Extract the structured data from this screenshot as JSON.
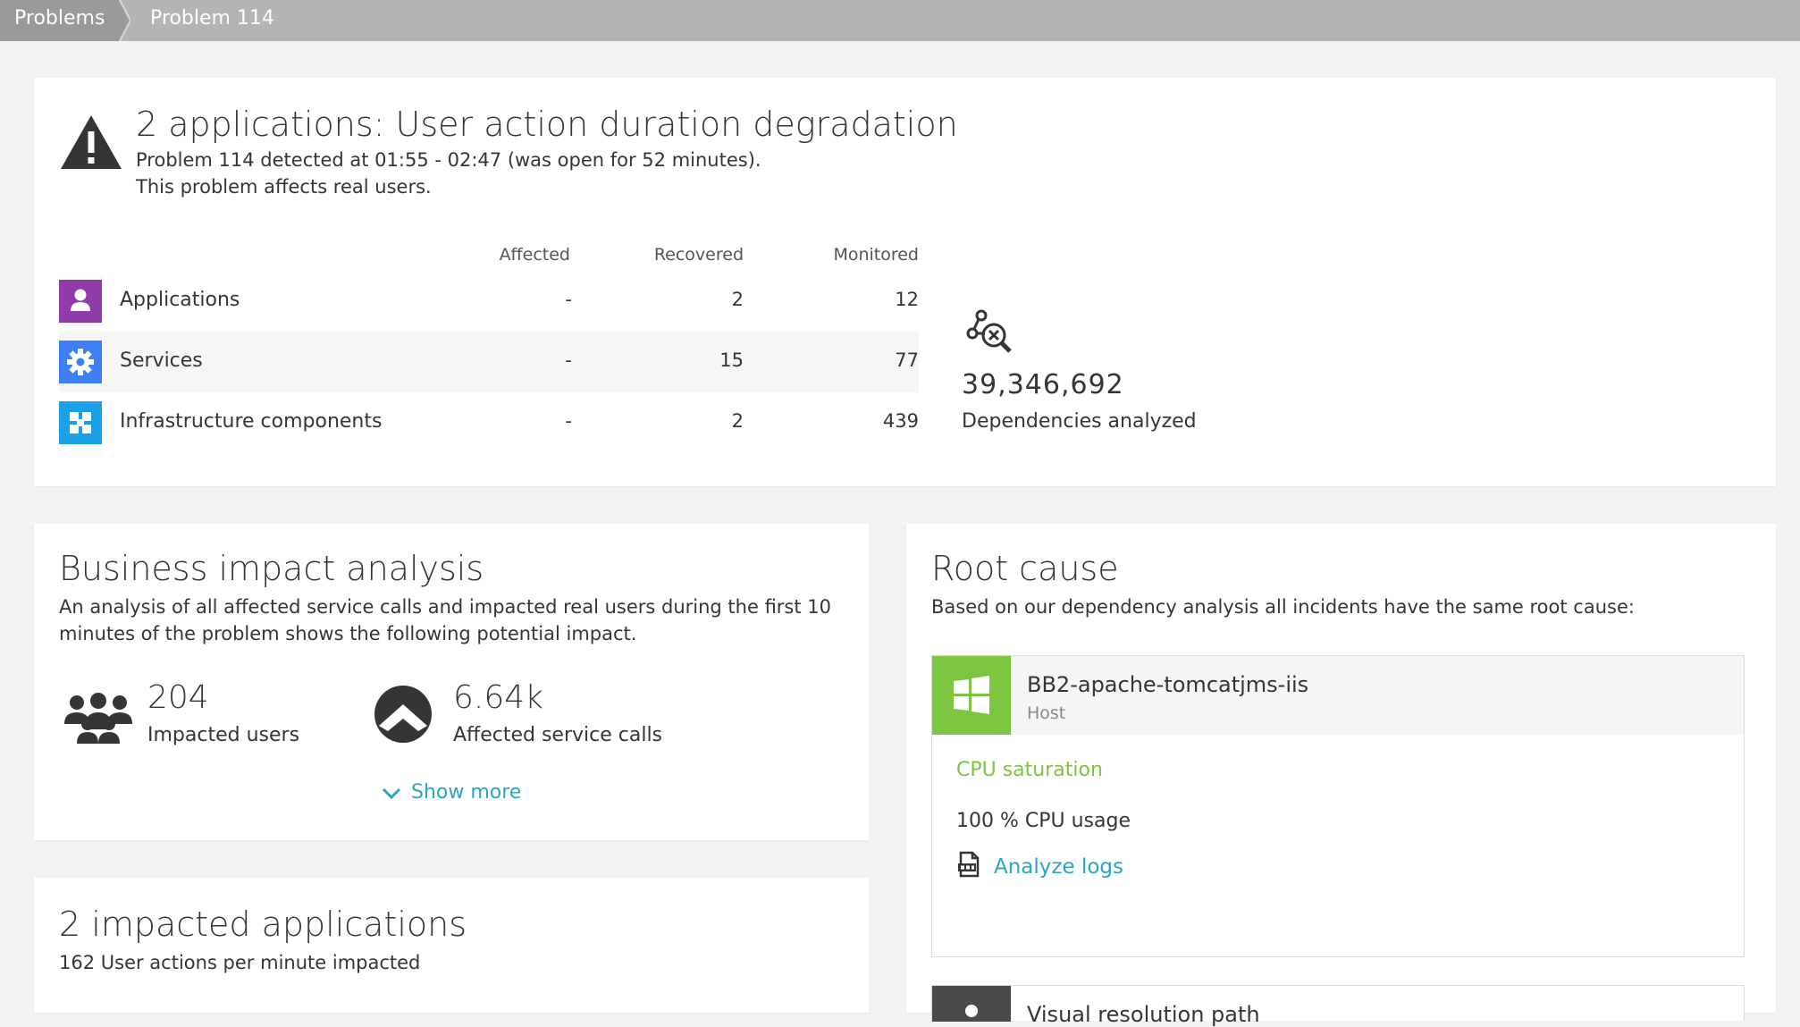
{
  "breadcrumb": {
    "items": [
      "Problems",
      "Problem 114"
    ]
  },
  "colors": {
    "accent_link": "#2aa5c5",
    "success_green": "#7dc540",
    "apps_purple": "#8f3ca8",
    "services_blue": "#3d7ff5",
    "infra_blue": "#1aa1e8"
  },
  "problem": {
    "title": "2 applications: User action duration degradation",
    "detected_line": "Problem 114 detected at 01:55 - 02:47 (was open for 52 minutes).",
    "affects_line": "This problem affects real users.",
    "icon": "warning-triangle-icon"
  },
  "entity_table": {
    "headers": [
      "Affected",
      "Recovered",
      "Monitored"
    ],
    "rows": [
      {
        "label": "Applications",
        "icon": "application-user-icon",
        "affected": "-",
        "recovered": "2",
        "monitored": "12"
      },
      {
        "label": "Services",
        "icon": "service-gear-icon",
        "affected": "-",
        "recovered": "15",
        "monitored": "77"
      },
      {
        "label": "Infrastructure components",
        "icon": "infrastructure-icon",
        "affected": "-",
        "recovered": "2",
        "monitored": "439"
      }
    ]
  },
  "dependencies": {
    "number": "39,346,692",
    "label": "Dependencies analyzed",
    "icon": "dependency-search-icon"
  },
  "business_impact": {
    "title": "Business impact analysis",
    "description_line1": "An analysis of all affected service calls and impacted real users during the first 10",
    "description_line2": "minutes of the problem shows the following potential impact.",
    "users_value": "204",
    "users_label": "Impacted users",
    "calls_value": "6.64k",
    "calls_label": "Affected service calls",
    "show_more": "Show more"
  },
  "impacted_apps": {
    "title": "2 impacted applications",
    "subtitle": "162 User actions per minute impacted"
  },
  "root_cause": {
    "title": "Root cause",
    "description": "Based on our dependency analysis all incidents have the same root cause:",
    "host_name": "BB2-apache-tomcatjms-iis",
    "host_type": "Host",
    "issue_title": "CPU saturation",
    "cpu_usage": "100 % CPU usage",
    "analyze_logs": "Analyze logs",
    "next_label": "Visual resolution path"
  }
}
